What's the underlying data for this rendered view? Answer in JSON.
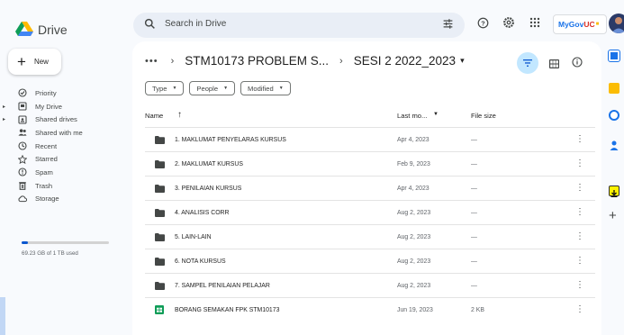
{
  "app": {
    "name": "Drive"
  },
  "search": {
    "placeholder": "Search in Drive"
  },
  "org_badge": {
    "text_a": "MyGov",
    "text_b": "UC"
  },
  "new_button": {
    "label": "New"
  },
  "sidebar": {
    "items": [
      {
        "label": "Priority",
        "icon": "priority-icon",
        "caret": false
      },
      {
        "label": "My Drive",
        "icon": "my-drive-icon",
        "caret": true
      },
      {
        "label": "Shared drives",
        "icon": "shared-drives-icon",
        "caret": true
      },
      {
        "label": "Shared with me",
        "icon": "shared-with-me-icon",
        "caret": false
      },
      {
        "label": "Recent",
        "icon": "recent-icon",
        "caret": false
      },
      {
        "label": "Starred",
        "icon": "star-icon",
        "caret": false
      },
      {
        "label": "Spam",
        "icon": "spam-icon",
        "caret": false
      },
      {
        "label": "Trash",
        "icon": "trash-icon",
        "caret": false
      },
      {
        "label": "Storage",
        "icon": "cloud-icon",
        "caret": false
      }
    ],
    "storage_text": "69.23 GB of 1 TB used",
    "storage_fraction": 0.07
  },
  "breadcrumb": {
    "dots": "•••",
    "parent": "STM10173 PROBLEM S...",
    "current": "SESI 2 2022_2023"
  },
  "filters": [
    {
      "label": "Type"
    },
    {
      "label": "People"
    },
    {
      "label": "Modified"
    }
  ],
  "table": {
    "headers": {
      "name": "Name",
      "modified": "Last mo...",
      "size": "File size"
    },
    "rows": [
      {
        "name": "1. MAKLUMAT PENYELARAS KURSUS",
        "modified": "Apr 4, 2023",
        "size": "—",
        "type": "folder"
      },
      {
        "name": "2. MAKLUMAT KURSUS",
        "modified": "Feb 9, 2023",
        "size": "—",
        "type": "folder"
      },
      {
        "name": "3. PENILAIAN KURSUS",
        "modified": "Apr 4, 2023",
        "size": "—",
        "type": "folder"
      },
      {
        "name": "4. ANALISIS CORR",
        "modified": "Aug 2, 2023",
        "size": "—",
        "type": "folder"
      },
      {
        "name": "5. LAIN-LAIN",
        "modified": "Aug 2, 2023",
        "size": "—",
        "type": "folder"
      },
      {
        "name": "6. NOTA KURSUS",
        "modified": "Aug 2, 2023",
        "size": "—",
        "type": "folder"
      },
      {
        "name": "7. SAMPEL PENILAIAN PELAJAR",
        "modified": "Aug 2, 2023",
        "size": "—",
        "type": "folder"
      },
      {
        "name": "BORANG SEMAKAN FPK STM10173",
        "modified": "Jun 19, 2023",
        "size": "2 KB",
        "type": "sheet"
      }
    ]
  },
  "colors": {
    "accent": "#0b57d0",
    "filter_active": "#c2e7ff",
    "folder": "#444746",
    "sheet": "#0f9d58"
  }
}
